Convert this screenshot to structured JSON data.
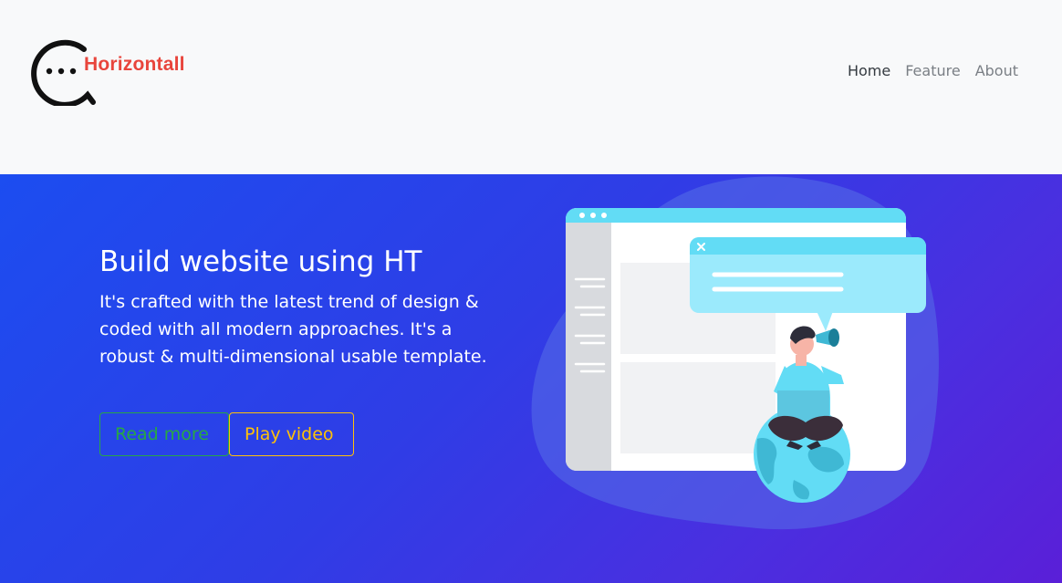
{
  "brand": {
    "name": "Horizontall"
  },
  "nav": {
    "items": [
      {
        "label": "Home",
        "active": true
      },
      {
        "label": "Feature",
        "active": false
      },
      {
        "label": "About",
        "active": false
      }
    ]
  },
  "hero": {
    "title": "Build website using HT",
    "text": "It's crafted with the latest trend of design & coded with all modern approaches. It's a robust & multi-dimensional usable template.",
    "buttons": {
      "read_more": "Read more",
      "play_video": "Play video"
    }
  },
  "colors": {
    "brand_text": "#e8453c",
    "hero_gradient_start": "#1c4df0",
    "hero_gradient_end": "#5a1fd8",
    "button_success": "#28a745",
    "button_warning": "#ffc107"
  },
  "icons": {
    "logo": "chat-bubble-logo-icon",
    "close": "close-icon"
  }
}
